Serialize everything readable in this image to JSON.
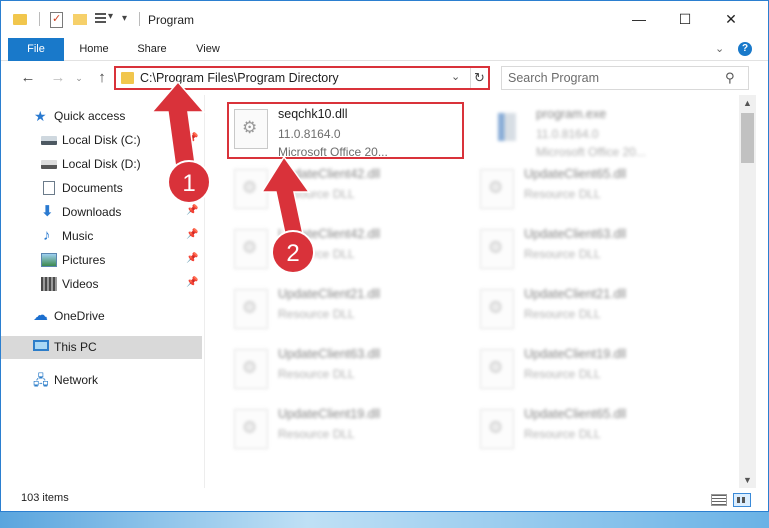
{
  "window": {
    "title": "Program"
  },
  "ribbon": {
    "file": "File",
    "home": "Home",
    "share": "Share",
    "view": "View"
  },
  "address": {
    "path": "C:\\Program Files\\Program Directory"
  },
  "search": {
    "placeholder": "Search Program"
  },
  "sidebar": {
    "items": [
      {
        "label": "Quick access",
        "icon": "star-icon"
      },
      {
        "label": "Local Disk (C:)",
        "icon": "drive-icon",
        "pinned": true
      },
      {
        "label": "Local Disk (D:)",
        "icon": "drive-icon"
      },
      {
        "label": "Documents",
        "icon": "documents-icon"
      },
      {
        "label": "Downloads",
        "icon": "downloads-icon",
        "pinned": true
      },
      {
        "label": "Music",
        "icon": "music-icon",
        "pinned": true
      },
      {
        "label": "Pictures",
        "icon": "pictures-icon",
        "pinned": true
      },
      {
        "label": "Videos",
        "icon": "videos-icon",
        "pinned": true
      },
      {
        "label": "OneDrive",
        "icon": "cloud-icon"
      },
      {
        "label": "This PC",
        "icon": "computer-icon",
        "selected": true
      },
      {
        "label": "Network",
        "icon": "network-icon"
      }
    ]
  },
  "files": [
    {
      "name": "seqchk10.dll",
      "line2": "11.0.8164.0",
      "line3": "Microsoft Office 20..."
    },
    {
      "name": "program.exe",
      "line2": "11.0.8164.0",
      "line3": "Microsoft Office 20..."
    },
    {
      "name": "UpdateClient42.dll",
      "line2": "Resource DLL"
    },
    {
      "name": "UpdateClient65.dll",
      "line2": "Resource DLL"
    },
    {
      "name": "UpdateClient42.dll",
      "line2": "Resource DLL"
    },
    {
      "name": "UpdateClient63.dll",
      "line2": "Resource DLL"
    },
    {
      "name": "UpdateClient21.dll",
      "line2": "Resource DLL"
    },
    {
      "name": "UpdateClient21.dll",
      "line2": "Resource DLL"
    },
    {
      "name": "UpdateClient63.dll",
      "line2": "Resource DLL"
    },
    {
      "name": "UpdateClient19.dll",
      "line2": "Resource DLL"
    },
    {
      "name": "UpdateClient19.dll",
      "line2": "Resource DLL"
    },
    {
      "name": "UpdateClient65.dll",
      "line2": "Resource DLL"
    }
  ],
  "status": {
    "count": "103 items"
  },
  "annotations": {
    "step1": "1",
    "step2": "2",
    "color": "#d9323a"
  }
}
